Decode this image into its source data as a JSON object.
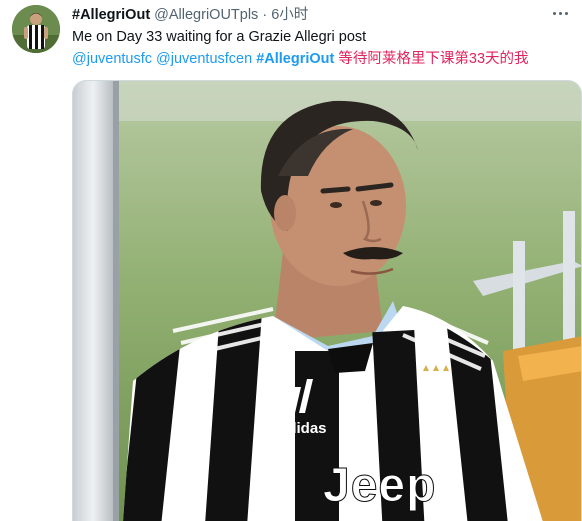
{
  "tweet": {
    "display_name": "#AllegriOut",
    "handle": "@AllegriOUTpls",
    "separator": "·",
    "time": "6小时",
    "text_line1": "Me on Day 33 waiting for a Grazie Allegri post",
    "mention1": "@juventusfc",
    "mention2": "@juventusfcen",
    "hashtag": "#AllegriOut",
    "chinese_text": "等待阿莱格里下课第33天的我"
  },
  "media": {
    "shirt_brand": "Jeep",
    "shirt_maker": "adidas"
  },
  "colors": {
    "link": "#1d9bf0",
    "chinese_text": "#e0245e",
    "secondary_text": "#536471"
  },
  "icons": {
    "more": "more-dots-icon"
  }
}
